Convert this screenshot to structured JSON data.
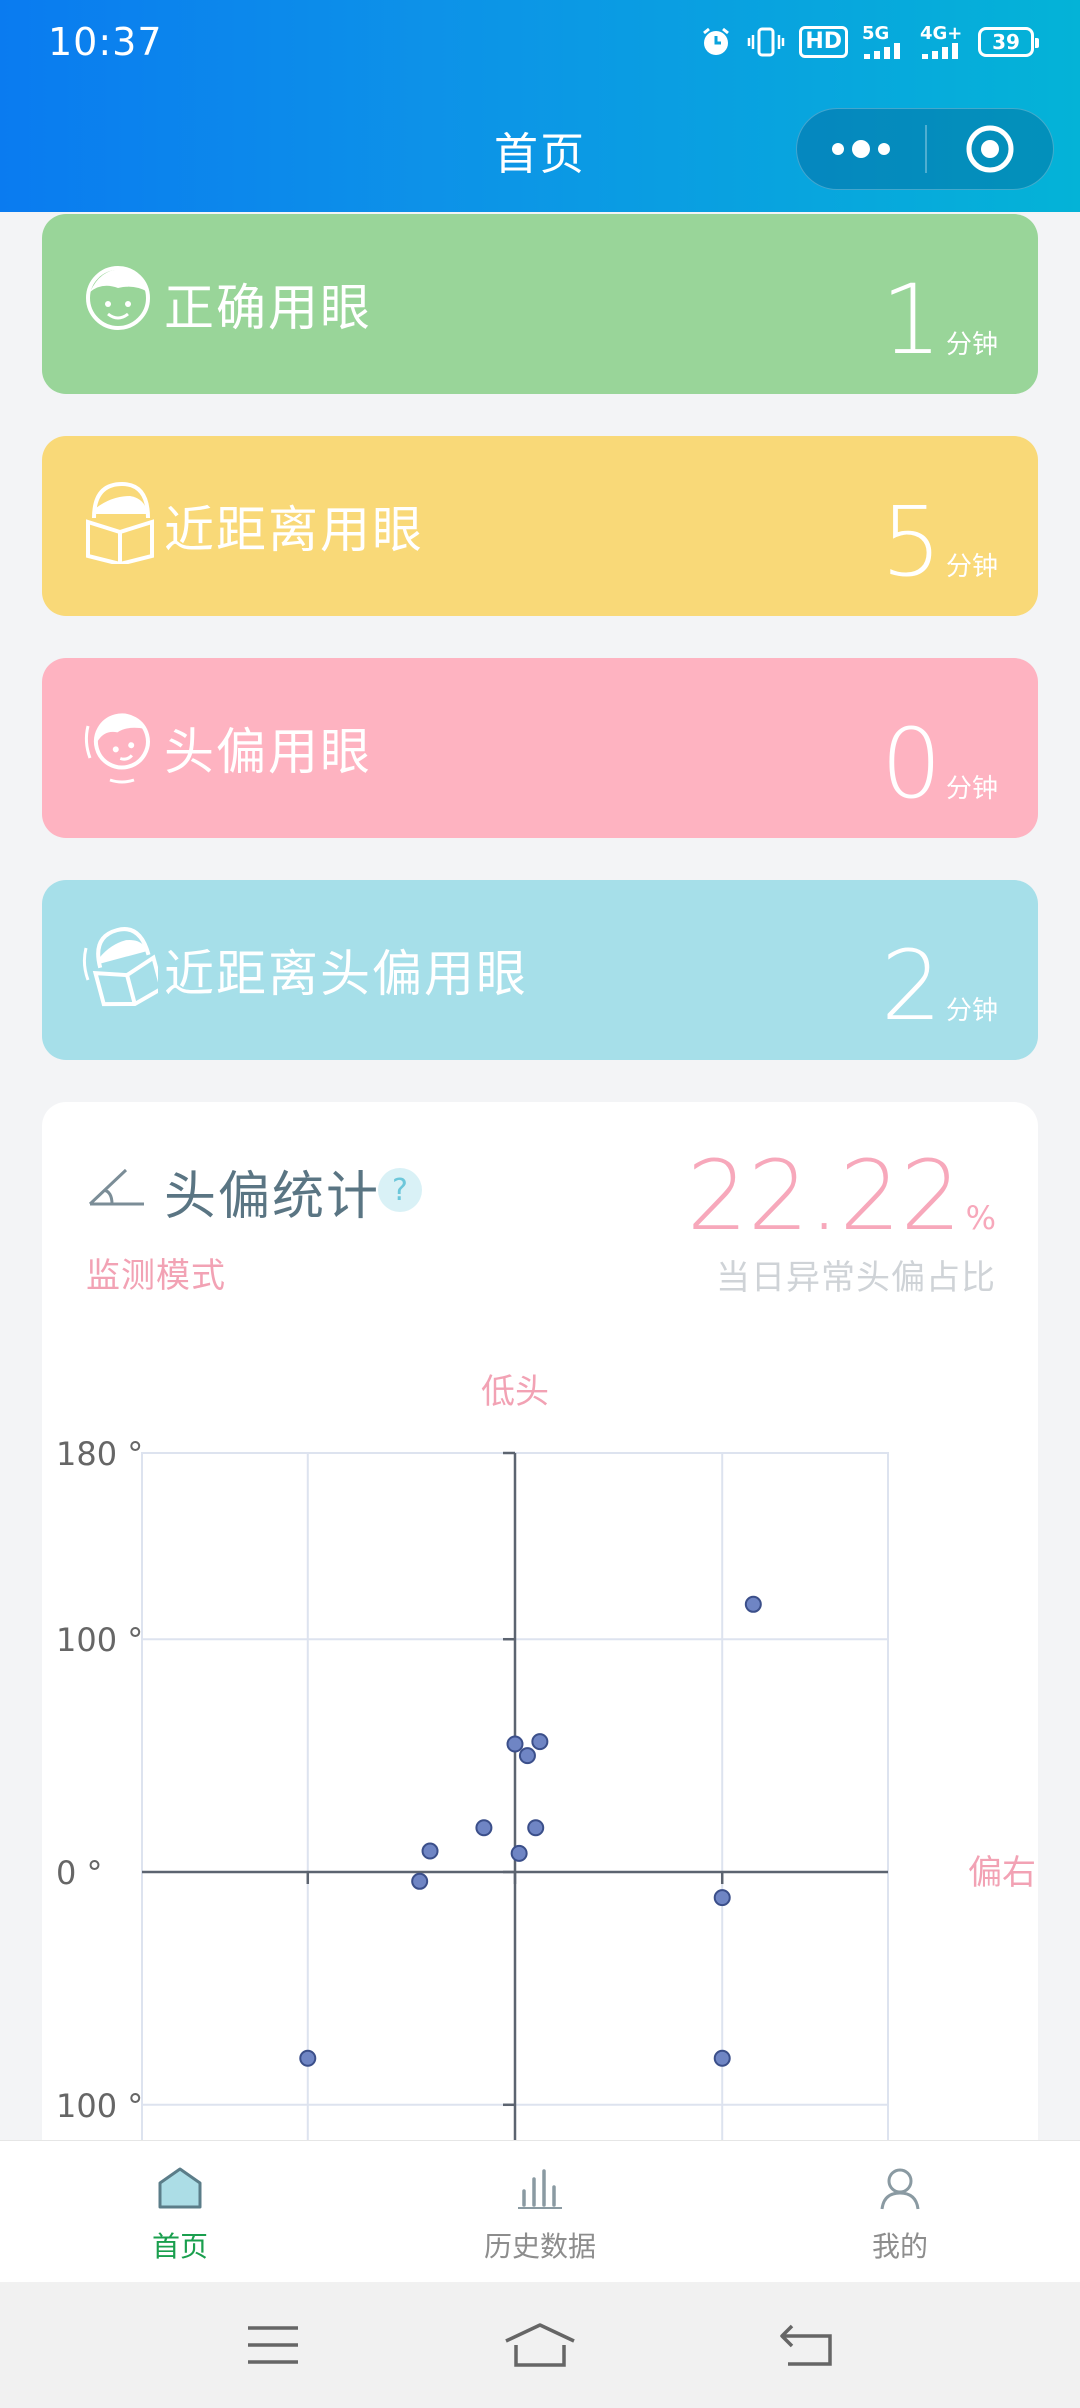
{
  "status_bar": {
    "time": "10:37",
    "network_1": "5G",
    "network_2": "4G+",
    "hd_label": "HD",
    "battery": "39"
  },
  "header": {
    "title": "首页",
    "more_icon": "more-dots-icon",
    "close_icon": "target-circle-icon"
  },
  "cards": [
    {
      "label": "正确用眼",
      "value": "1",
      "unit": "分钟",
      "color": "#99d599",
      "icon": "happy-face-icon"
    },
    {
      "label": "近距离用眼",
      "value": "5",
      "unit": "分钟",
      "color": "#f9d978",
      "icon": "face-book-icon"
    },
    {
      "label": "头偏用眼",
      "value": "0",
      "unit": "分钟",
      "color": "#feb3c1",
      "icon": "tilted-face-icon"
    },
    {
      "label": "近距离头偏用眼",
      "value": "2",
      "unit": "分钟",
      "color": "#a6dfe9",
      "icon": "tilted-book-icon"
    }
  ],
  "tilt_stats": {
    "title": "头偏统计",
    "help": "?",
    "mode_label": "监测模式",
    "percent_value": "22.22",
    "percent_unit": "%",
    "percent_label": "当日异常头偏占比"
  },
  "chart_data": {
    "type": "scatter",
    "title": "",
    "top_label": "低头",
    "right_label": "偏右",
    "y_tick_labels": [
      "180 °",
      "100 °",
      "0 °",
      "100 °"
    ],
    "y_ticks": [
      180,
      100,
      0,
      -100
    ],
    "ylim": [
      -120,
      180
    ],
    "xlim": [
      -180,
      180
    ],
    "x_grid": [
      -180,
      -100,
      0,
      100,
      180
    ],
    "grid": true,
    "points": [
      {
        "x": 115,
        "y": 115
      },
      {
        "x": 0,
        "y": 55
      },
      {
        "x": 6,
        "y": 50
      },
      {
        "x": 12,
        "y": 56
      },
      {
        "x": -15,
        "y": 19
      },
      {
        "x": 10,
        "y": 19
      },
      {
        "x": -41,
        "y": 9
      },
      {
        "x": 2,
        "y": 8
      },
      {
        "x": -46,
        "y": -4
      },
      {
        "x": 100,
        "y": -11
      },
      {
        "x": -100,
        "y": -80
      },
      {
        "x": 100,
        "y": -80
      }
    ]
  },
  "tabbar": {
    "items": [
      {
        "label": "首页",
        "icon": "home-icon",
        "active": true
      },
      {
        "label": "历史数据",
        "icon": "bar-chart-icon",
        "active": false
      },
      {
        "label": "我的",
        "icon": "user-icon",
        "active": false
      }
    ]
  },
  "android_nav": {
    "menu_icon": "menu-icon",
    "home_icon": "home-outline-icon",
    "back_icon": "back-icon"
  }
}
